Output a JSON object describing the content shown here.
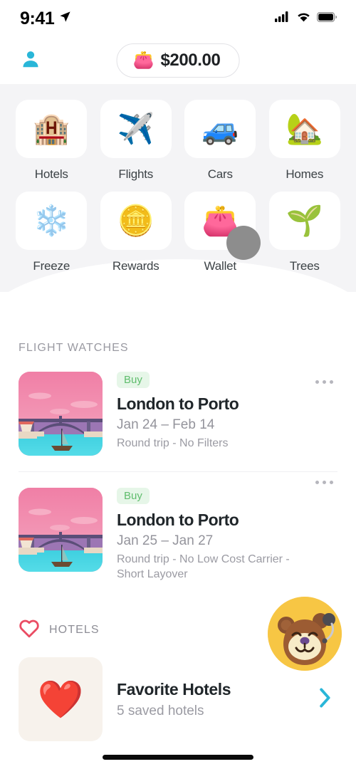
{
  "status_bar": {
    "time": "9:41",
    "location_icon": "location-arrow-icon",
    "signal_icon": "cellular-signal-icon",
    "wifi_icon": "wifi-icon",
    "battery_icon": "battery-full-icon"
  },
  "top_bar": {
    "profile_icon": "person-icon",
    "wallet": {
      "icon": "wallet-emoji",
      "emoji": "👛",
      "amount": "$200.00"
    }
  },
  "categories": [
    {
      "label": "Hotels",
      "emoji": "🏨",
      "icon": "hotel-icon"
    },
    {
      "label": "Flights",
      "emoji": "✈️",
      "icon": "airplane-icon"
    },
    {
      "label": "Cars",
      "emoji": "🚙",
      "icon": "car-icon"
    },
    {
      "label": "Homes",
      "emoji": "🏡",
      "icon": "house-icon"
    },
    {
      "label": "Freeze",
      "emoji": "❄️",
      "icon": "snowflake-icon"
    },
    {
      "label": "Rewards",
      "emoji": "🪙",
      "icon": "coin-icon"
    },
    {
      "label": "Wallet",
      "emoji": "👛",
      "icon": "wallet-icon"
    },
    {
      "label": "Trees",
      "emoji": "🌱",
      "icon": "seedling-icon"
    }
  ],
  "flight_watches": {
    "section_label": "FLIGHT WATCHES",
    "items": [
      {
        "badge": "Buy",
        "title": "London to Porto",
        "dates": "Jan 24 – Feb 14",
        "filters": "Round trip - No Filters",
        "thumbnail": "porto-bridge-thumbnail",
        "menu_icon": "more-options-icon"
      },
      {
        "badge": "Buy",
        "title": "London to Porto",
        "dates": "Jan 25 – Jan 27",
        "filters": "Round trip - No Low Cost Carrier - Short Layover",
        "thumbnail": "porto-bridge-thumbnail",
        "menu_icon": "more-options-icon"
      }
    ]
  },
  "hotels": {
    "section_label": "HOTELS",
    "heart_icon": "heart-outline-icon",
    "favorite": {
      "emoji": "❤️",
      "title": "Favorite Hotels",
      "subtitle": "5 saved hotels",
      "chevron_icon": "chevron-right-icon"
    }
  },
  "mascot": {
    "icon": "bear-support-mascot"
  },
  "cursor": {
    "indicator": "touch-indicator",
    "over": "Wallet"
  },
  "colors": {
    "accent_cyan": "#29b6d8",
    "panel_bg": "#f4f4f6",
    "badge_bg": "#e6f6e8",
    "badge_text": "#5fbd6d",
    "heart_pink": "#ea4c63",
    "mascot_bg": "#f7c644",
    "text_primary": "#20262a",
    "text_muted": "#9b9ba3"
  }
}
